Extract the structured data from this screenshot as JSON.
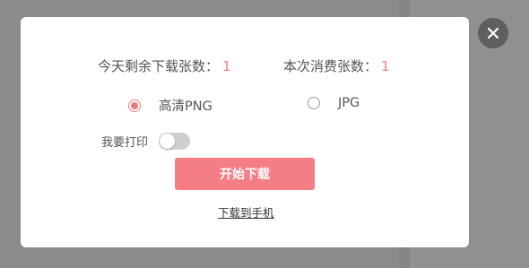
{
  "dialog": {
    "quota": {
      "today_remaining_label": "今天剩余下载张数：",
      "today_remaining_value": "1",
      "this_time_label": "本次消费张数：",
      "this_time_value": "1"
    },
    "format_options": [
      {
        "label": "高清PNG",
        "selected": true
      },
      {
        "label": "JPG",
        "selected": false
      }
    ],
    "print": {
      "label": "我要打印",
      "enabled": false
    },
    "start_button": "开始下载",
    "download_to_phone": "下载到手机"
  },
  "colors": {
    "accent": "#f57d85",
    "overlay": "#8f8f8f",
    "close_bg": "#5f5f5f"
  },
  "icons": {
    "close": "close-icon"
  }
}
